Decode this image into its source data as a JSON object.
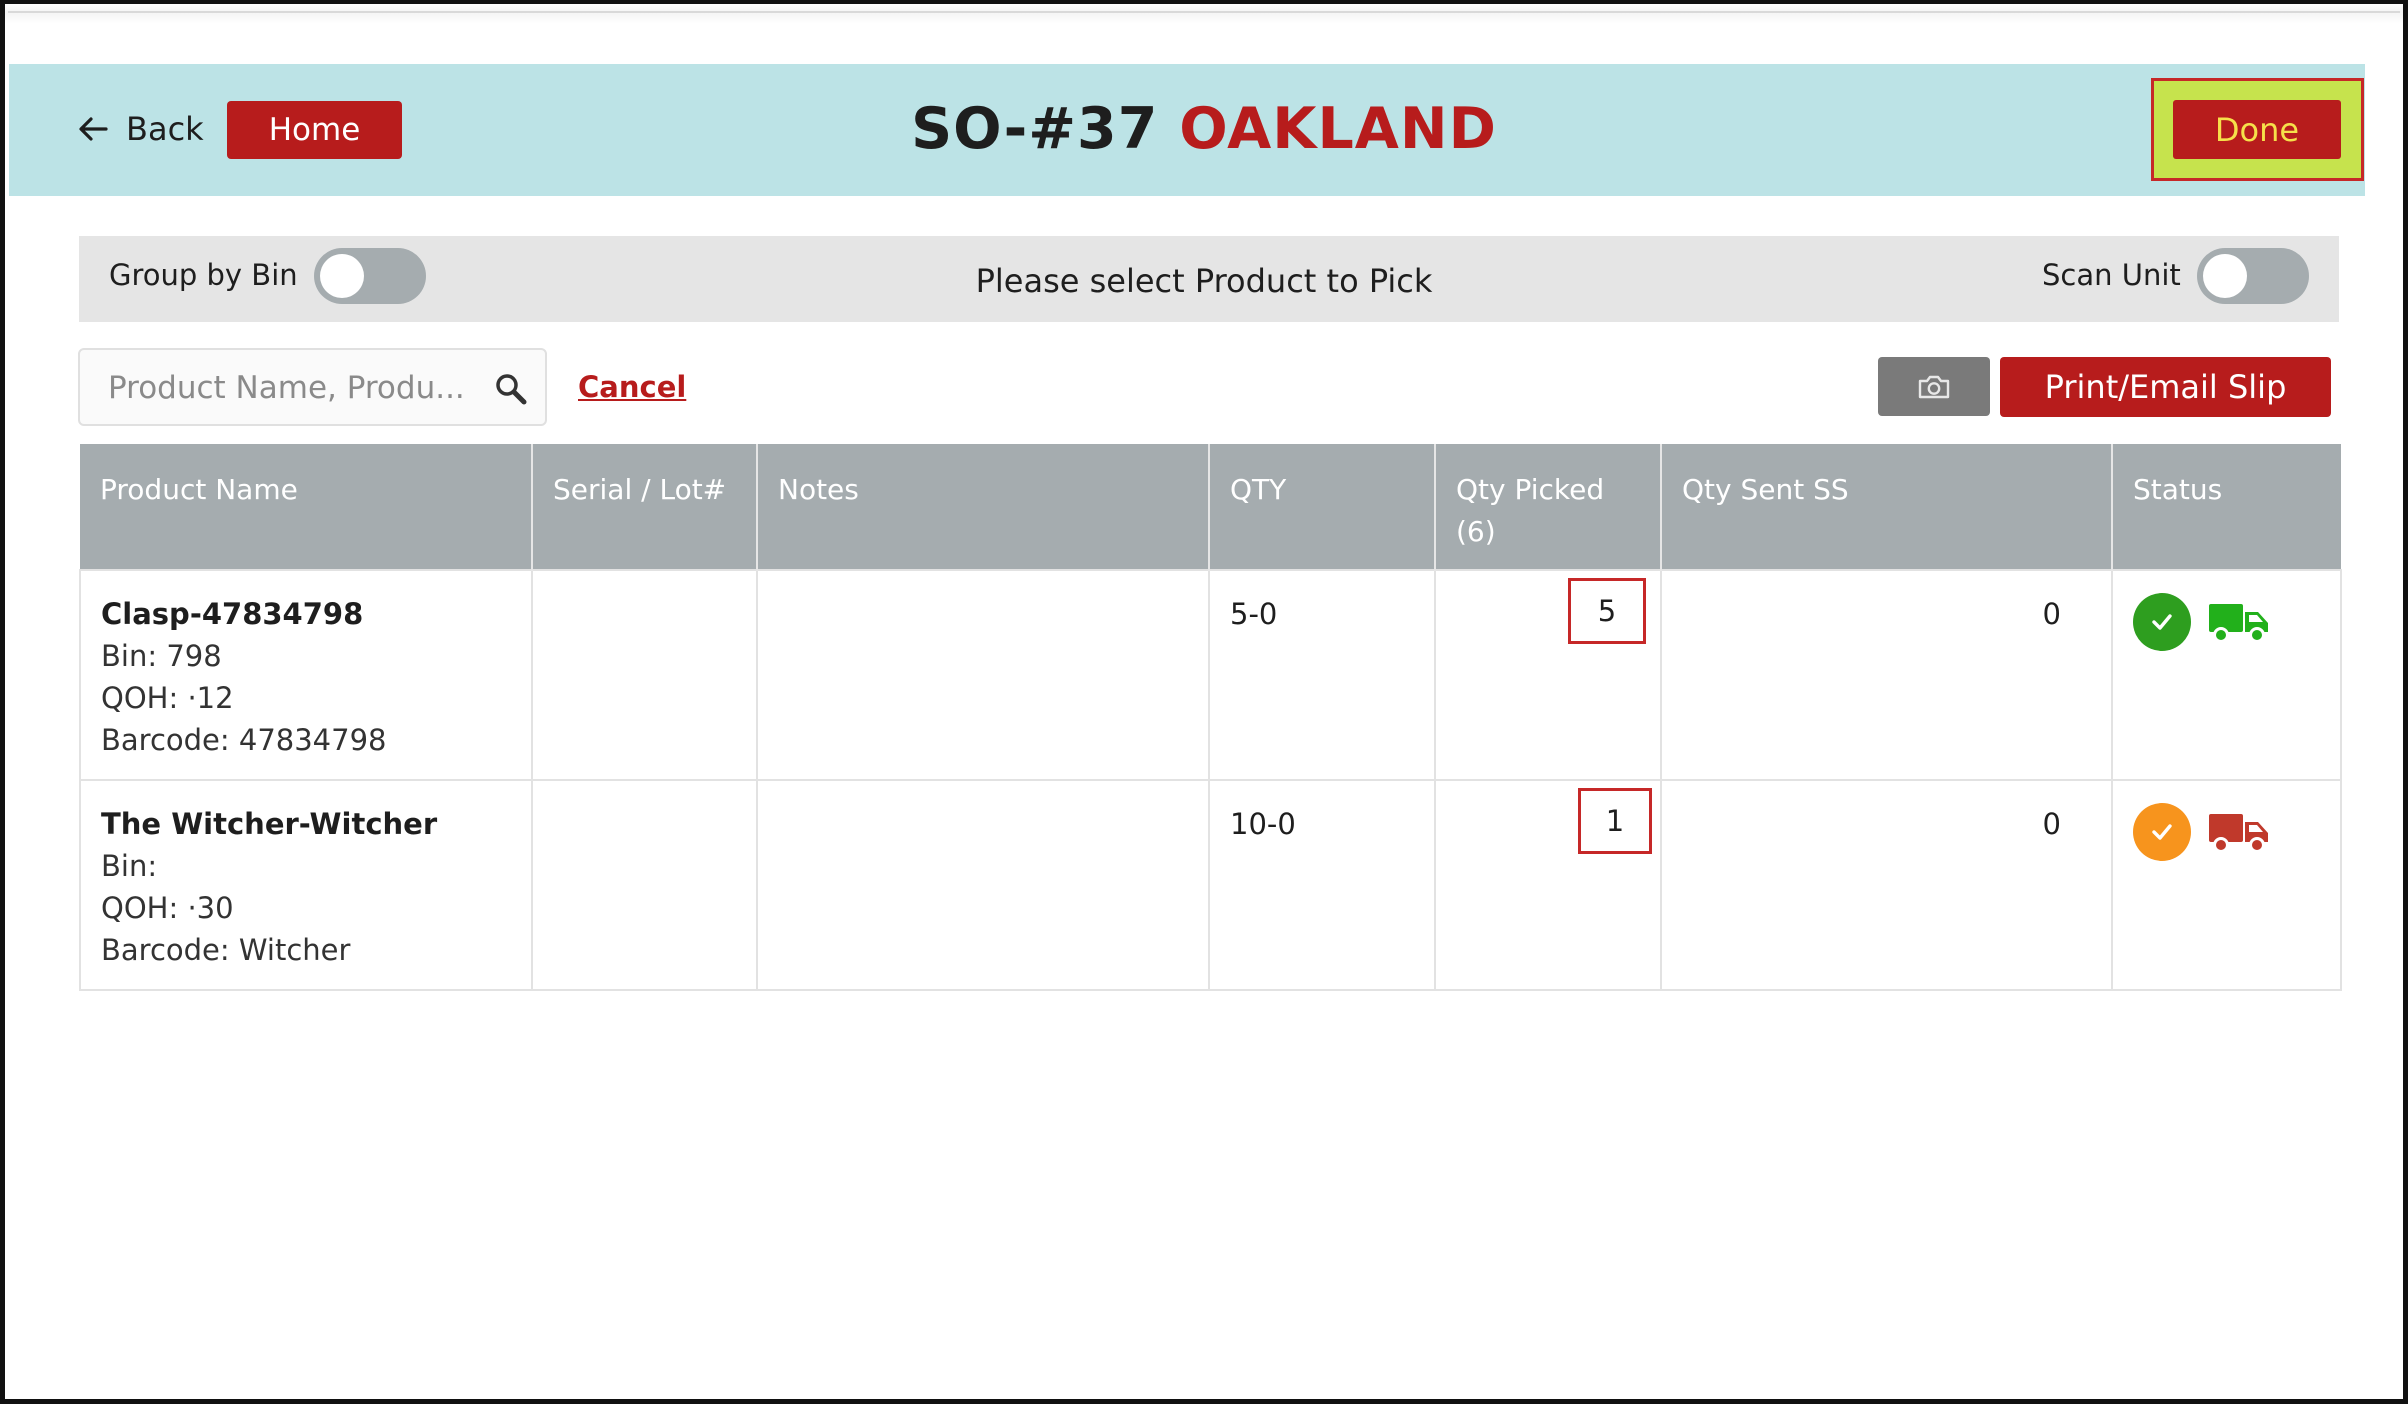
{
  "header": {
    "back_label": "Back",
    "home_label": "Home",
    "order_number": "SO-#37",
    "location": "OAKLAND",
    "done_label": "Done",
    "accent_color": "#b71c1c",
    "header_bg": "#bce3e6"
  },
  "toolbar": {
    "group_by_bin_label": "Group by Bin",
    "group_by_bin_on": false,
    "prompt": "Please select Product to Pick",
    "scan_unit_label": "Scan Unit",
    "scan_unit_on": false
  },
  "actions": {
    "search_placeholder": "Product Name, Produ...",
    "cancel_label": "Cancel",
    "camera_icon": "camera-icon",
    "print_label": "Print/Email Slip"
  },
  "table": {
    "headers": {
      "product_name": "Product Name",
      "serial_lot": "Serial / Lot#",
      "notes": "Notes",
      "qty": "QTY",
      "qty_picked": "Qty Picked",
      "qty_picked_total": "(6)",
      "qty_sent": "Qty Sent SS",
      "status": "Status"
    },
    "rows": [
      {
        "name": "Clasp-47834798",
        "bin": "Bin: 798",
        "qoh": "QOH:  ·12",
        "barcode": "Barcode: 47834798",
        "serial": "",
        "notes": "",
        "qty": "5-0",
        "qty_picked": "5",
        "qty_sent": "0",
        "status_color": "#2e9e1f",
        "truck_color": "#22b01b"
      },
      {
        "name": "The Witcher-Witcher",
        "bin": "Bin:",
        "qoh": "QOH:  ·30",
        "barcode": "Barcode: Witcher",
        "serial": "",
        "notes": "",
        "qty": "10-0",
        "qty_picked": "1",
        "qty_sent": "0",
        "status_color": "#f7941d",
        "truck_color": "#c0392b"
      }
    ]
  }
}
